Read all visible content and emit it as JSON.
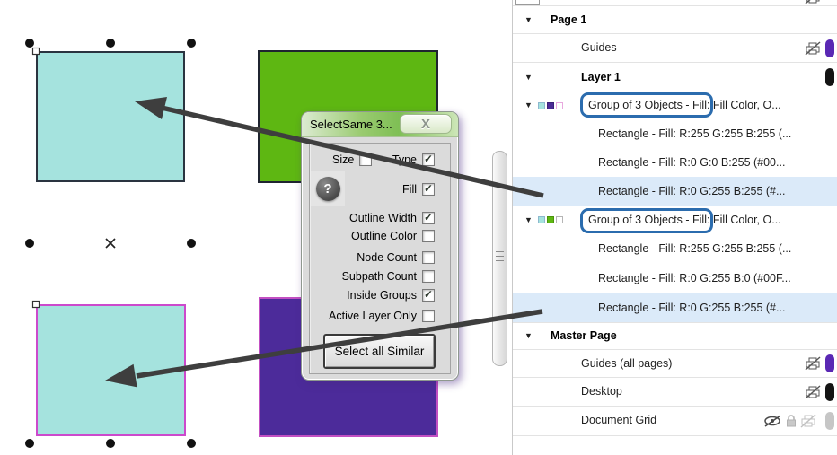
{
  "icons": {
    "collapse": "▼",
    "close": "X",
    "help": "?",
    "center_marker": "×"
  },
  "dialog": {
    "title": "SelectSame 3...",
    "close": "X",
    "help": "?",
    "checkboxes": [
      {
        "label": "Size",
        "checked": false,
        "mark": ""
      },
      {
        "label": "Type",
        "checked": true,
        "mark": "✓"
      },
      {
        "label": "Fill",
        "checked": true,
        "mark": "✓"
      },
      {
        "label": "Outline Width",
        "checked": true,
        "mark": "✓"
      },
      {
        "label": "Outline Color",
        "checked": false,
        "mark": ""
      },
      {
        "label": "Node Count",
        "checked": false,
        "mark": ""
      },
      {
        "label": "Subpath Count",
        "checked": false,
        "mark": ""
      },
      {
        "label": "Inside Groups",
        "checked": true,
        "mark": "✓"
      },
      {
        "label": "Active Layer Only",
        "checked": false,
        "mark": ""
      }
    ],
    "button": "Select all Similar"
  },
  "panel": {
    "rows": [
      {
        "id": "page-1",
        "label": "Page 1",
        "bold": true
      },
      {
        "id": "guides",
        "label": "Guides",
        "non_printable": true,
        "pill_color": "#5A28B4"
      },
      {
        "id": "layer-1",
        "label": "Layer 1",
        "bold": true,
        "pill_color": "#141414"
      },
      {
        "id": "group-1",
        "label": "Group of 3 Objects - Fill: Fill Color, O...",
        "callout": true,
        "mini_swatches": [
          "#A5E3DE",
          "#4A2B96",
          "#FFFFFF"
        ]
      },
      {
        "id": "rect-white-1",
        "label": "Rectangle - Fill: R:255 G:255 B:255 (...",
        "swatch": "#FFFFFF",
        "swatch_border": "#E8A8DE"
      },
      {
        "id": "rect-blue",
        "label": "Rectangle - Fill: R:0 G:0 B:255 (#00...",
        "swatch": "#4A2B96"
      },
      {
        "id": "rect-cyan-1",
        "label": "Rectangle - Fill: R:0 G:255 B:255 (#...",
        "swatch": "#B5E6E4",
        "highlighted": true
      },
      {
        "id": "group-2",
        "label": "Group of 3 Objects - Fill: Fill Color, O...",
        "callout": true,
        "mini_swatches": [
          "#A5E3DE",
          "#5EB712",
          "#FFFFFF"
        ]
      },
      {
        "id": "rect-white-2",
        "label": "Rectangle - Fill: R:255 G:255 B:255 (...",
        "swatch": "#FFFFFF",
        "swatch_border": "#B5B5B5"
      },
      {
        "id": "rect-green",
        "label": "Rectangle - Fill: R:0 G:255 B:0 (#00F...",
        "swatch": "#5EB712"
      },
      {
        "id": "rect-cyan-2",
        "label": "Rectangle - Fill: R:0 G:255 B:255 (#...",
        "swatch": "#B5E6E4",
        "highlighted": true
      },
      {
        "id": "master-page",
        "label": "Master Page",
        "bold": true
      },
      {
        "id": "guides-all-pages",
        "label": "Guides (all pages)",
        "non_printable": true,
        "pill_color": "#5A28B4"
      },
      {
        "id": "desktop",
        "label": "Desktop",
        "non_printable": true,
        "pill_color": "#141414"
      },
      {
        "id": "document-grid",
        "label": "Document Grid",
        "hidden": true,
        "locked": true,
        "non_printable": true,
        "pill_color": "#C6C6C6"
      }
    ]
  },
  "canvas": {
    "rectangles": [
      {
        "name": "cyan-top",
        "fill": "#A5E3DE",
        "outline": "#2A3440"
      },
      {
        "name": "green",
        "fill": "#5EB712",
        "outline": "#1F2430"
      },
      {
        "name": "cyan-bottom",
        "fill": "#A5E3DE",
        "outline": "#CC49CC"
      },
      {
        "name": "purple",
        "fill": "#4C2B9A",
        "outline": "#C24FC2"
      }
    ],
    "selection": {
      "handle_color": "#111111",
      "center_marker": "×"
    }
  },
  "colors": {
    "highlight_row": "#DBEAF9",
    "callout_blue": "#2B6CAE",
    "arrow": "#3E3E3E",
    "titlebar_green": "#7FBF55",
    "dialog_bg": "#DBDBDB"
  }
}
